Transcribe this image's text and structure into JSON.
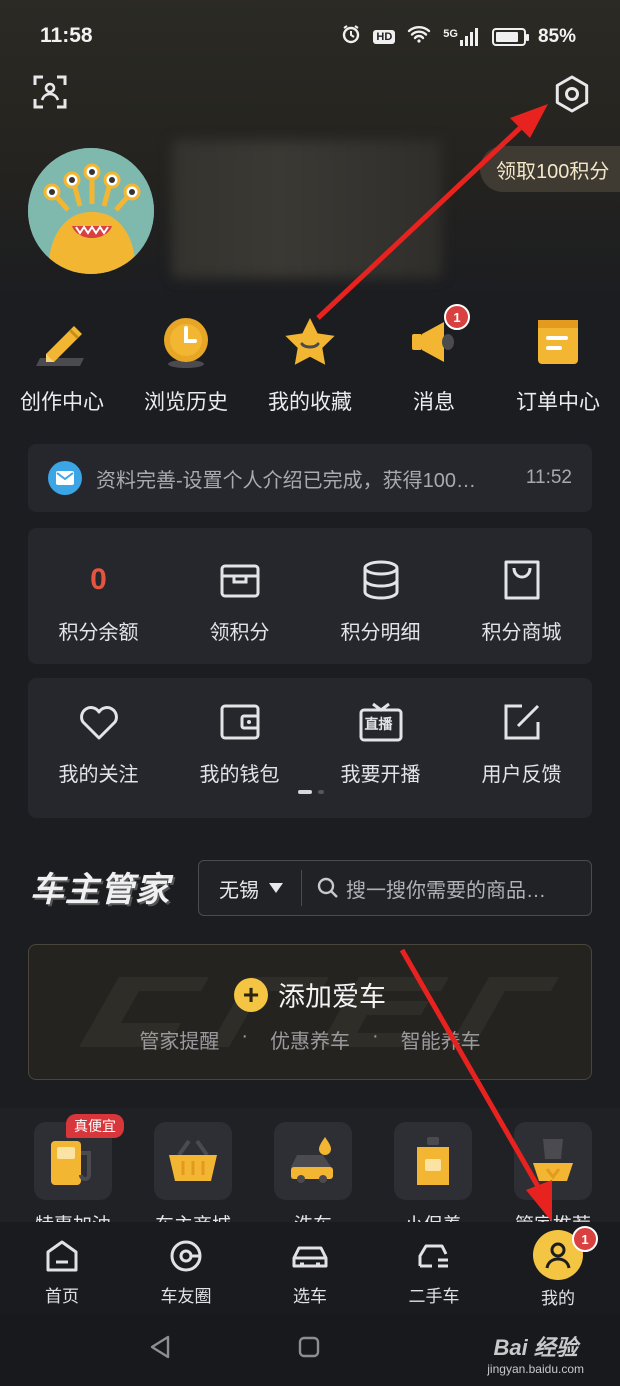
{
  "status_bar": {
    "time": "11:58",
    "hd": "HD",
    "net": "5G",
    "battery": "85%",
    "battery_level": 0.85
  },
  "header": {
    "points_pill": "领取100积分"
  },
  "quick_actions": [
    {
      "label": "创作中心",
      "icon": "pencil-icon"
    },
    {
      "label": "浏览历史",
      "icon": "clock-icon"
    },
    {
      "label": "我的收藏",
      "icon": "star-icon"
    },
    {
      "label": "消息",
      "icon": "megaphone-icon",
      "badge": "1"
    },
    {
      "label": "订单中心",
      "icon": "order-icon"
    }
  ],
  "notice": {
    "text": "资料完善-设置个人介绍已完成，获得100…",
    "time": "11:52"
  },
  "points_card": [
    {
      "label": "积分余额",
      "value": "0"
    },
    {
      "label": "领积分",
      "icon": "box-icon"
    },
    {
      "label": "积分明细",
      "icon": "database-icon"
    },
    {
      "label": "积分商城",
      "icon": "shopping-bag-icon"
    }
  ],
  "tools_card": [
    {
      "label": "我的关注",
      "icon": "heart-icon"
    },
    {
      "label": "我的钱包",
      "icon": "wallet-icon"
    },
    {
      "label": "我要开播",
      "icon": "live-tv-icon",
      "icon_text": "直播"
    },
    {
      "label": "用户反馈",
      "icon": "feedback-edit-icon"
    }
  ],
  "butler": {
    "title": "车主管家",
    "city": "无锡",
    "search_placeholder": "搜一搜你需要的商品…"
  },
  "add_car": {
    "label": "添加爱车",
    "subs": [
      "管家提醒",
      "·",
      "优惠养车",
      "·",
      "智能养车"
    ]
  },
  "services": [
    {
      "label": "特惠加油",
      "tag": "真便宜",
      "icon": "fuel-pump-icon"
    },
    {
      "label": "车主商城",
      "icon": "basket-icon"
    },
    {
      "label": "洗车",
      "icon": "car-wash-icon"
    },
    {
      "label": "小保养",
      "icon": "oil-can-icon"
    },
    {
      "label": "管家推荐",
      "icon": "car-seat-icon"
    }
  ],
  "tabbar": [
    {
      "label": "首页",
      "icon": "home-icon"
    },
    {
      "label": "车友圈",
      "icon": "circle-icon"
    },
    {
      "label": "选车",
      "icon": "car-icon"
    },
    {
      "label": "二手车",
      "icon": "used-car-icon"
    },
    {
      "label": "我的",
      "icon": "user-icon",
      "badge": "1",
      "active": true
    }
  ],
  "watermark": {
    "main": "Bai 经验",
    "sub": "jingyan.baidu.com"
  }
}
